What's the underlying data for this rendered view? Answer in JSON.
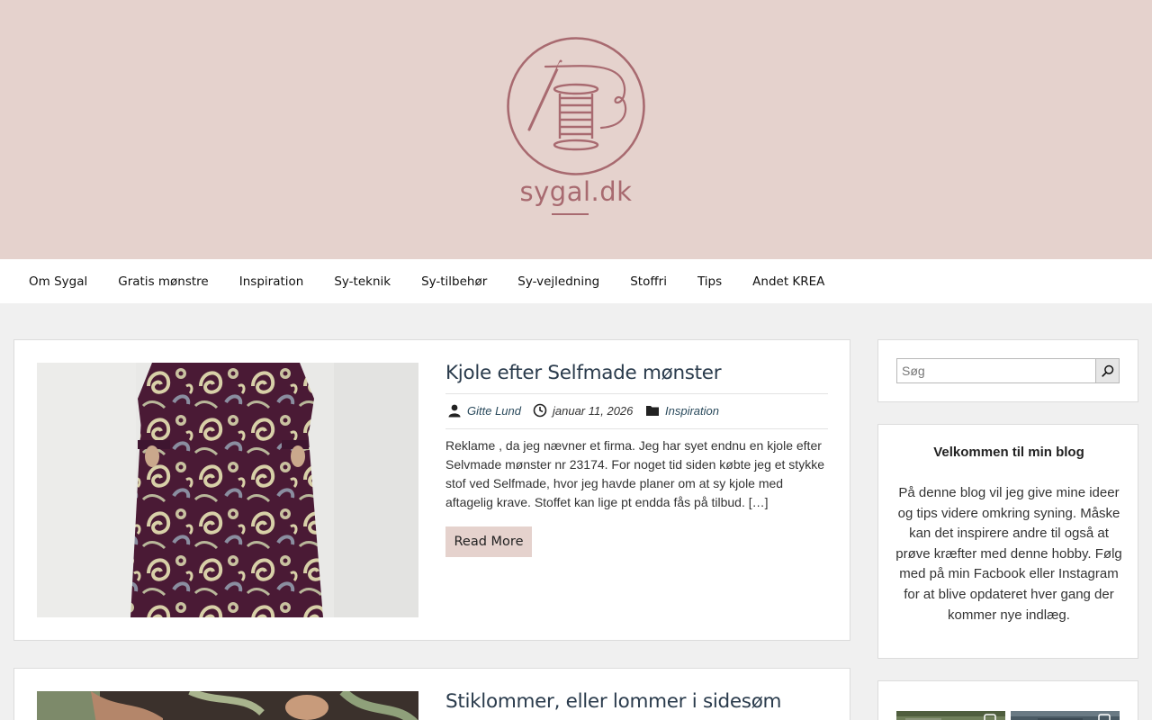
{
  "site": {
    "logo_text": "sygal.dk",
    "colors": {
      "header_bg": "#e5d2cd",
      "logo": "#a86a70",
      "title": "#2a3b4c",
      "link": "#2a4a5c",
      "button_bg": "#e5d2cd",
      "page_bg": "#f0f0f0"
    }
  },
  "nav": {
    "items": [
      {
        "label": "Om Sygal"
      },
      {
        "label": "Gratis mønstre"
      },
      {
        "label": "Inspiration"
      },
      {
        "label": "Sy-teknik"
      },
      {
        "label": "Sy-tilbehør"
      },
      {
        "label": "Sy-vejledning"
      },
      {
        "label": "Stoffri"
      },
      {
        "label": "Tips"
      },
      {
        "label": "Andet KREA"
      }
    ]
  },
  "posts": [
    {
      "title": "Kjole efter Selfmade mønster",
      "author": "Gitte Lund",
      "date": "januar 11, 2026",
      "category": "Inspiration",
      "excerpt": "Reklame , da jeg nævner et firma. Jeg har syet endnu en kjole efter Selvmade mønster nr 23174. For noget tid siden købte jeg et stykke stof ved Selfmade, hvor jeg havde planer om at sy kjole med aftagelig krave. Stoffet kan lige pt endda fås på tilbud. […]",
      "read_more": "Read More"
    },
    {
      "title": "Stiklommer, eller lommer i sidesøm"
    }
  ],
  "sidebar": {
    "search": {
      "placeholder": "Søg",
      "icon": "search-icon"
    },
    "welcome": {
      "title": "Velkommen til min blog",
      "body": "På denne blog vil jeg give mine ideer og tips videre omkring syning. Måske kan det inspirere andre til også at prøve kræfter med denne hobby. Følg med på min Facbook eller Instagram for at blive opdateret hver gang der kommer nye indlæg."
    }
  }
}
